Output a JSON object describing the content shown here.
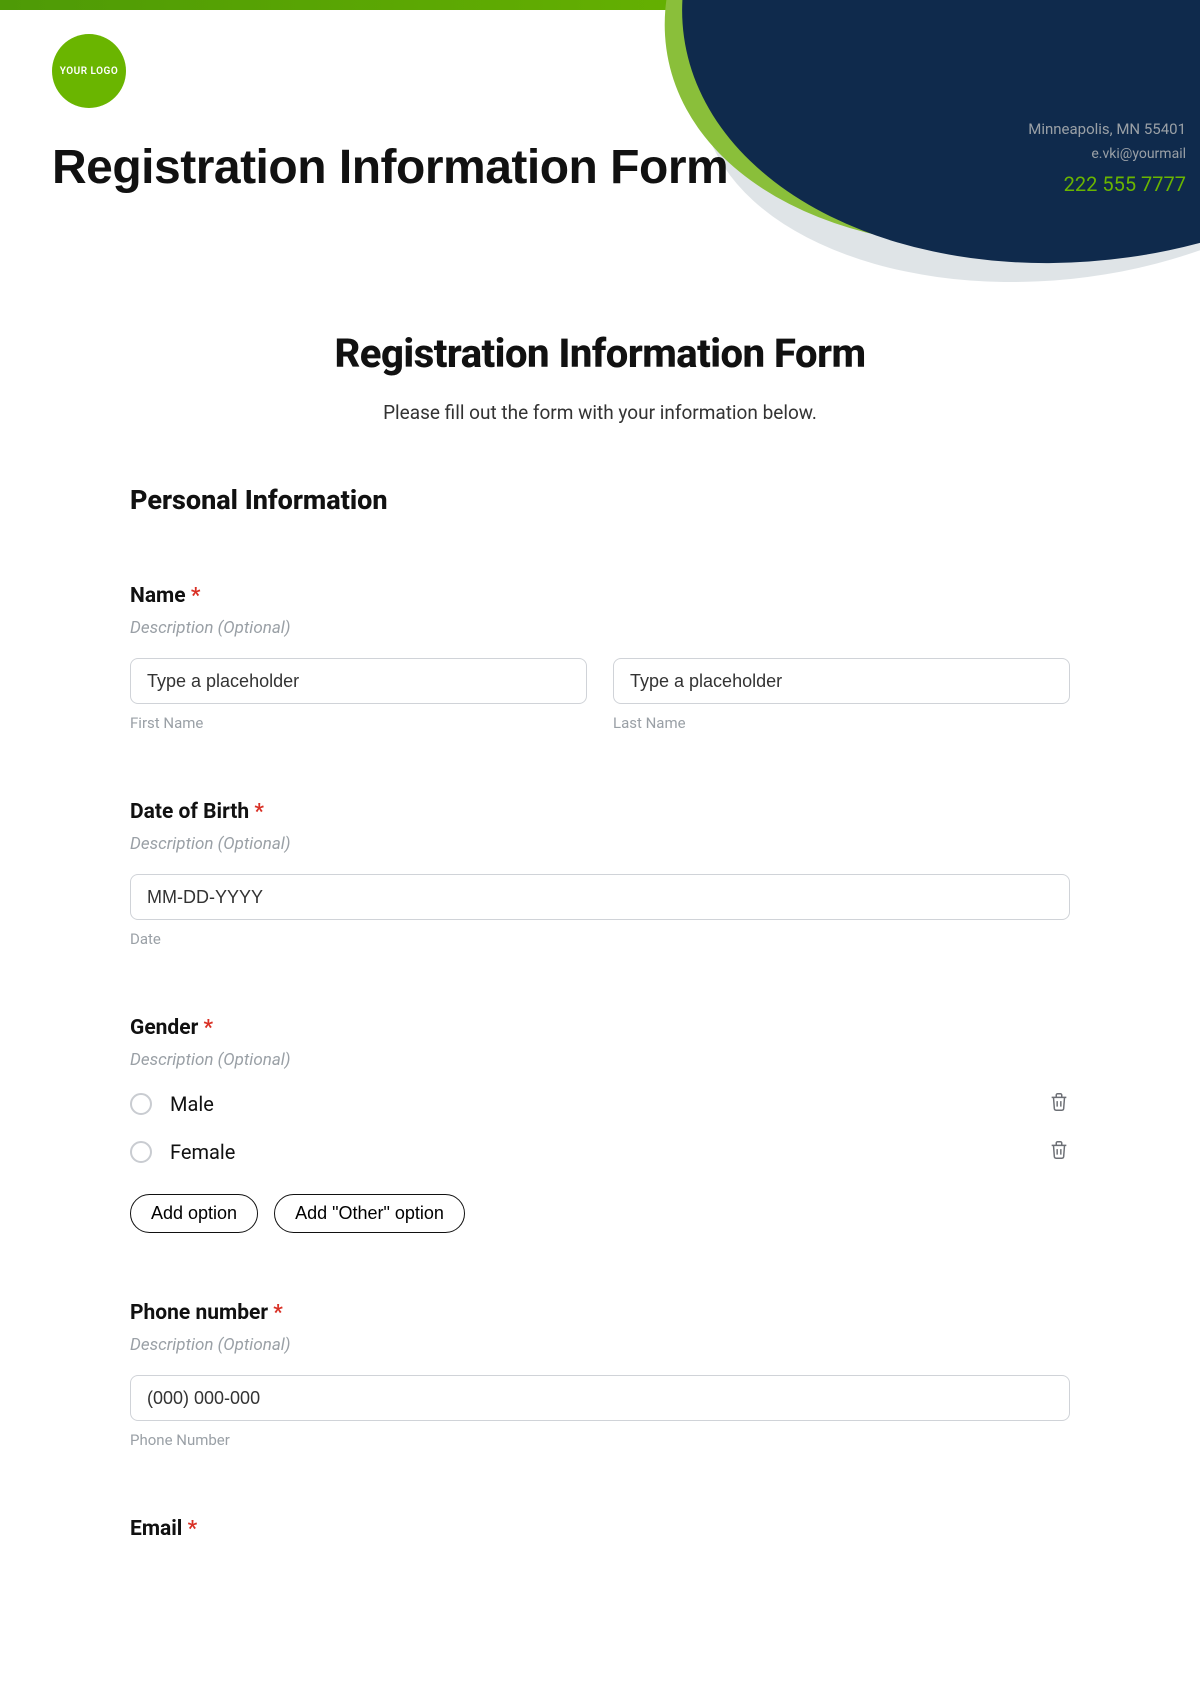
{
  "header": {
    "logo_text": "YOUR\nLOGO",
    "title": "Registration Information Form",
    "city": "Minneapolis, MN 55401",
    "email": "e.vki@yourmail",
    "phone": "222 555 7777"
  },
  "form": {
    "heading": "Registration Information Form",
    "subtitle": "Please fill out the form with your information below.",
    "section_personal": "Personal Information",
    "required_mark": "*",
    "name": {
      "label": "Name ",
      "description": "Description (Optional)",
      "first_placeholder": "Type a placeholder",
      "last_placeholder": "Type a placeholder",
      "first_sub": "First Name",
      "last_sub": "Last Name"
    },
    "dob": {
      "label": "Date of Birth ",
      "description": "Description (Optional)",
      "placeholder": "MM-DD-YYYY",
      "sub": "Date"
    },
    "gender": {
      "label": "Gender ",
      "description": "Description (Optional)",
      "options": [
        "Male",
        "Female"
      ],
      "add_option": "Add option",
      "add_other": "Add \"Other\" option"
    },
    "phone": {
      "label": "Phone number ",
      "description": "Description (Optional)",
      "placeholder": "(000) 000-000",
      "sub": "Phone Number"
    },
    "email": {
      "label": "Email "
    }
  }
}
